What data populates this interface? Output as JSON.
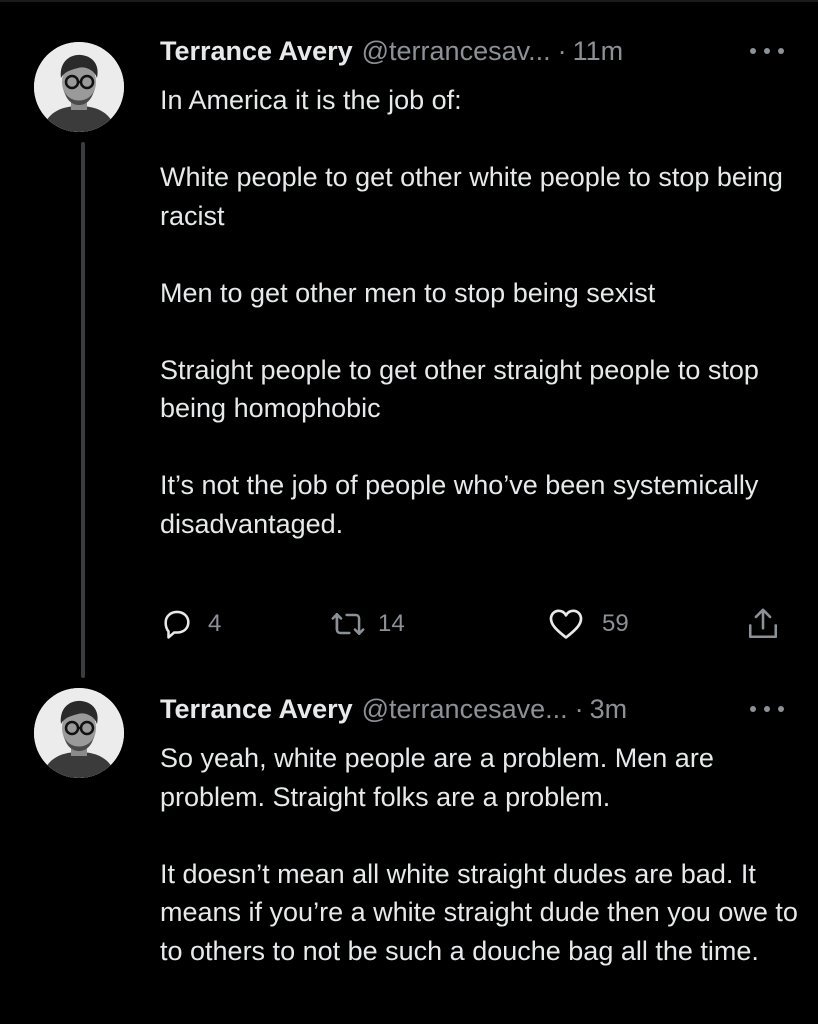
{
  "tweets": [
    {
      "author_name": "Terrance Avery",
      "author_handle": "@terrancesav...",
      "separator": "·",
      "timestamp": "11m",
      "paragraphs": [
        "In America it is the job of:",
        "White people to get other white people to stop being racist",
        "Men to get other men to stop being sexist",
        "Straight people to get other straight people to stop being homophobic",
        "It’s not the job of people who’ve been systemically disadvantaged."
      ],
      "stats": {
        "replies": "4",
        "retweets": "14",
        "likes": "59"
      }
    },
    {
      "author_name": "Terrance Avery",
      "author_handle": "@terrancesave...",
      "separator": "·",
      "timestamp": "3m",
      "paragraphs": [
        "So yeah, white people are a problem. Men are problem. Straight folks are a problem.",
        "It doesn’t mean all white straight dudes are bad. It means if you’re a white straight dude then you owe to to others to not be such a douche bag all the time."
      ]
    }
  ],
  "icons": {
    "more": "more-horizontal-icon",
    "reply": "reply-icon",
    "retweet": "retweet-icon",
    "like": "heart-icon",
    "share": "share-icon"
  },
  "colors": {
    "background": "#000000",
    "text": "#e7e9ea",
    "secondary_text": "#8b9196",
    "thread_line": "#3a3d40"
  }
}
